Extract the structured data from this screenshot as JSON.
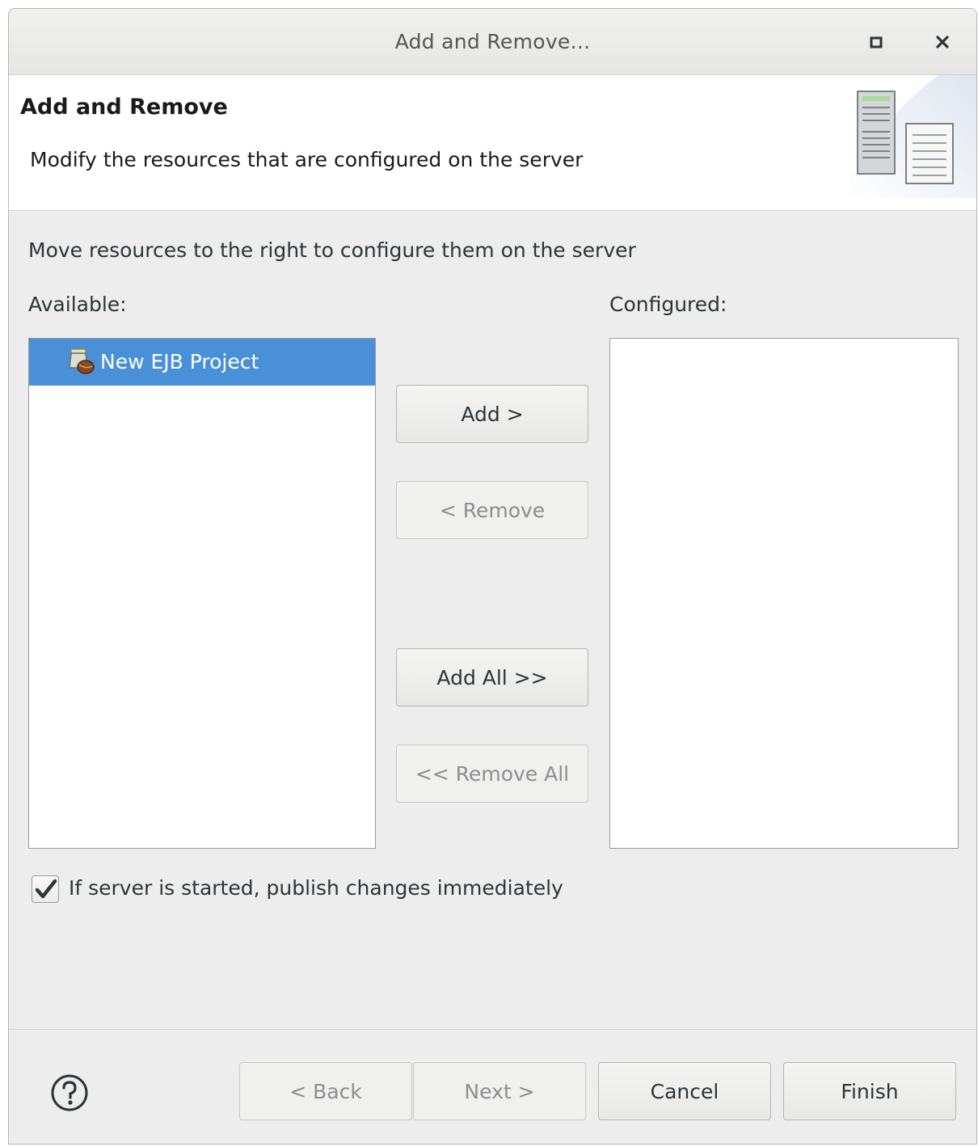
{
  "window": {
    "title": "Add and Remove...",
    "icons": [
      "maximize-icon",
      "close-icon"
    ]
  },
  "header": {
    "title": "Add and Remove",
    "description": "Modify the resources that are configured on the server",
    "banner_icon": "server-resources-icon"
  },
  "main": {
    "instruction": "Move resources to the right to configure them on the server",
    "available_label": "Available:",
    "configured_label": "Configured:",
    "available_items": [
      {
        "label": "New EJB Project",
        "icon": "ejb-project-icon",
        "selected": true
      }
    ],
    "configured_items": []
  },
  "buttons": {
    "add": "Add >",
    "remove": "< Remove",
    "add_all": "Add All >>",
    "remove_all": "<< Remove All"
  },
  "options": {
    "publish_label": "If server is started, publish changes immediately",
    "publish_checked": true
  },
  "footer": {
    "help_icon": "help-icon",
    "back": "< Back",
    "next": "Next >",
    "cancel": "Cancel",
    "finish": "Finish"
  },
  "colors": {
    "selection": "#4a90d9",
    "background": "#ededed",
    "disabled_text": "#8b8e8f"
  }
}
